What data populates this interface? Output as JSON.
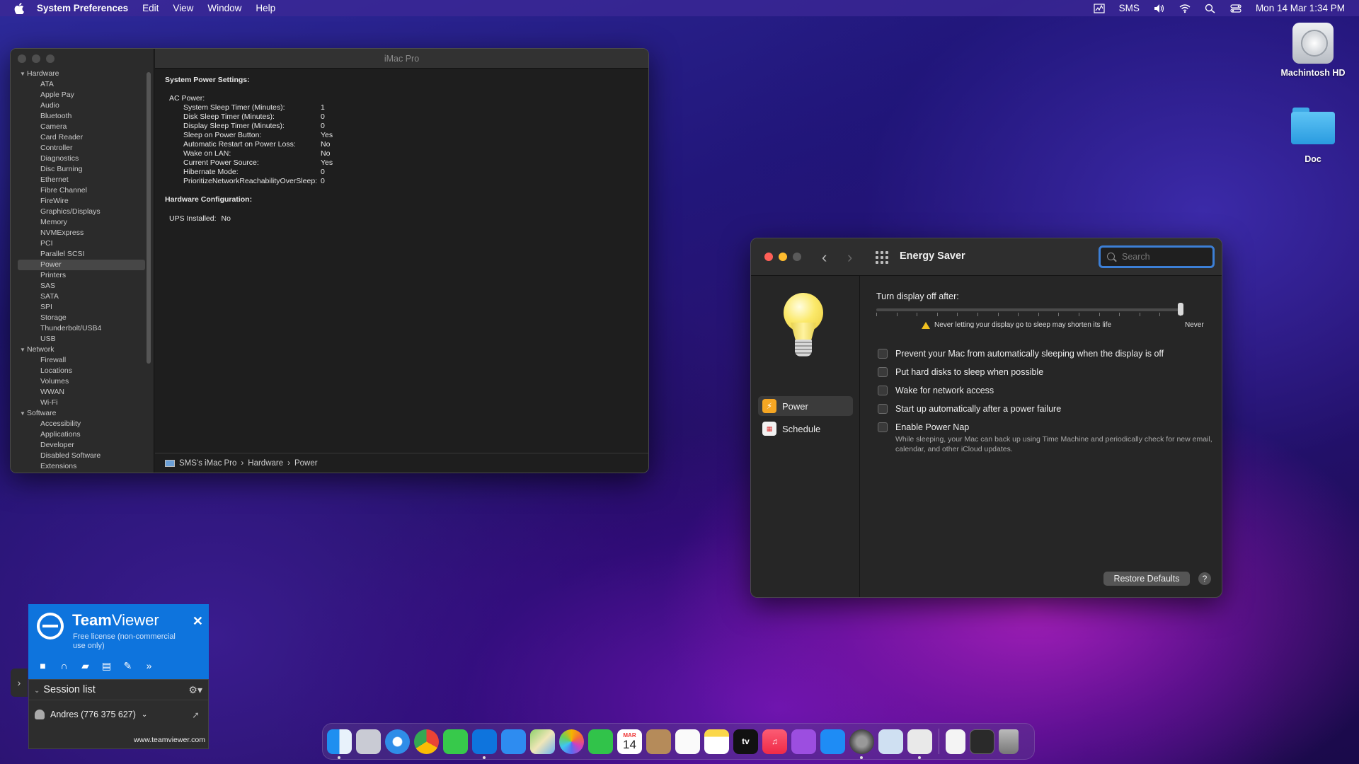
{
  "menubar": {
    "app": "System Preferences",
    "menus": [
      "Edit",
      "View",
      "Window",
      "Help"
    ],
    "user": "SMS",
    "datetime": "Mon 14 Mar  1:34 PM"
  },
  "desktop": {
    "icons": [
      {
        "label": "Machintosh HD"
      },
      {
        "label": "Doc"
      }
    ]
  },
  "sysinfo": {
    "title": "iMac Pro",
    "tree": {
      "hardware": "Hardware",
      "hardware_items": [
        "ATA",
        "Apple Pay",
        "Audio",
        "Bluetooth",
        "Camera",
        "Card Reader",
        "Controller",
        "Diagnostics",
        "Disc Burning",
        "Ethernet",
        "Fibre Channel",
        "FireWire",
        "Graphics/Displays",
        "Memory",
        "NVMExpress",
        "PCI",
        "Parallel SCSI",
        "Power",
        "Printers",
        "SAS",
        "SATA",
        "SPI",
        "Storage",
        "Thunderbolt/USB4",
        "USB"
      ],
      "network": "Network",
      "network_items": [
        "Firewall",
        "Locations",
        "Volumes",
        "WWAN",
        "Wi-Fi"
      ],
      "software": "Software",
      "software_items": [
        "Accessibility",
        "Applications",
        "Developer",
        "Disabled Software",
        "Extensions"
      ]
    },
    "content": {
      "heading1": "System Power Settings:",
      "ac_power": "AC Power:",
      "rows": [
        {
          "label": "System Sleep Timer (Minutes):",
          "value": "1"
        },
        {
          "label": "Disk Sleep Timer (Minutes):",
          "value": "0"
        },
        {
          "label": "Display Sleep Timer (Minutes):",
          "value": "0"
        },
        {
          "label": "Sleep on Power Button:",
          "value": "Yes"
        },
        {
          "label": "Automatic Restart on Power Loss:",
          "value": "No"
        },
        {
          "label": "Wake on LAN:",
          "value": "No"
        },
        {
          "label": "Current Power Source:",
          "value": "Yes"
        },
        {
          "label": "Hibernate Mode:",
          "value": "0"
        },
        {
          "label": "PrioritizeNetworkReachabilityOverSleep:",
          "value": "0"
        }
      ],
      "heading2": "Hardware Configuration:",
      "ups_label": "UPS Installed:",
      "ups_value": "No"
    },
    "breadcrumb": [
      "SMS's iMac Pro",
      "Hardware",
      "Power"
    ],
    "breadcrumb_sep": "›"
  },
  "energy": {
    "title": "Energy Saver",
    "search_placeholder": "Search",
    "sidebar": [
      {
        "label": "Power",
        "selected": true
      },
      {
        "label": "Schedule",
        "selected": false
      }
    ],
    "display_off_label": "Turn display off after:",
    "slider_value": "Never",
    "slider_fraction": 1.0,
    "warning": "Never letting your display go to sleep may shorten its life",
    "options": [
      {
        "label": "Prevent your Mac from automatically sleeping when the display is off",
        "checked": false
      },
      {
        "label": "Put hard disks to sleep when possible",
        "checked": false
      },
      {
        "label": "Wake for network access",
        "checked": false
      },
      {
        "label": "Start up automatically after a power failure",
        "checked": false
      },
      {
        "label": "Enable Power Nap",
        "checked": false
      }
    ],
    "power_nap_note": "While sleeping, your Mac can back up using Time Machine and periodically check for new email, calendar, and other iCloud updates.",
    "restore_label": "Restore Defaults",
    "help_label": "?"
  },
  "teamviewer": {
    "brand_bold": "Team",
    "brand_rest": "Viewer",
    "license": "Free license (non-commercial use only)",
    "session_list": "Session list",
    "user": "Andres (776 375 627)",
    "url": "www.teamviewer.com"
  },
  "dock": {
    "calendar_month": "MAR",
    "calendar_day": "14",
    "tv_label": "tv",
    "apps": [
      "finder-icon",
      "launchpad-icon",
      "safari-icon",
      "chrome-icon",
      "messages-icon",
      "teamviewer-icon",
      "mail-icon",
      "maps-icon",
      "photos-icon",
      "facetime-icon",
      "calendar-icon",
      "contacts-icon",
      "reminders-icon",
      "notes-icon",
      "appletv-icon",
      "music-icon",
      "podcasts-icon",
      "appstore-icon",
      "system-preferences-icon",
      "preview-icon",
      "printer-icon",
      "document-icon",
      "screen-icon",
      "trash-icon"
    ]
  }
}
